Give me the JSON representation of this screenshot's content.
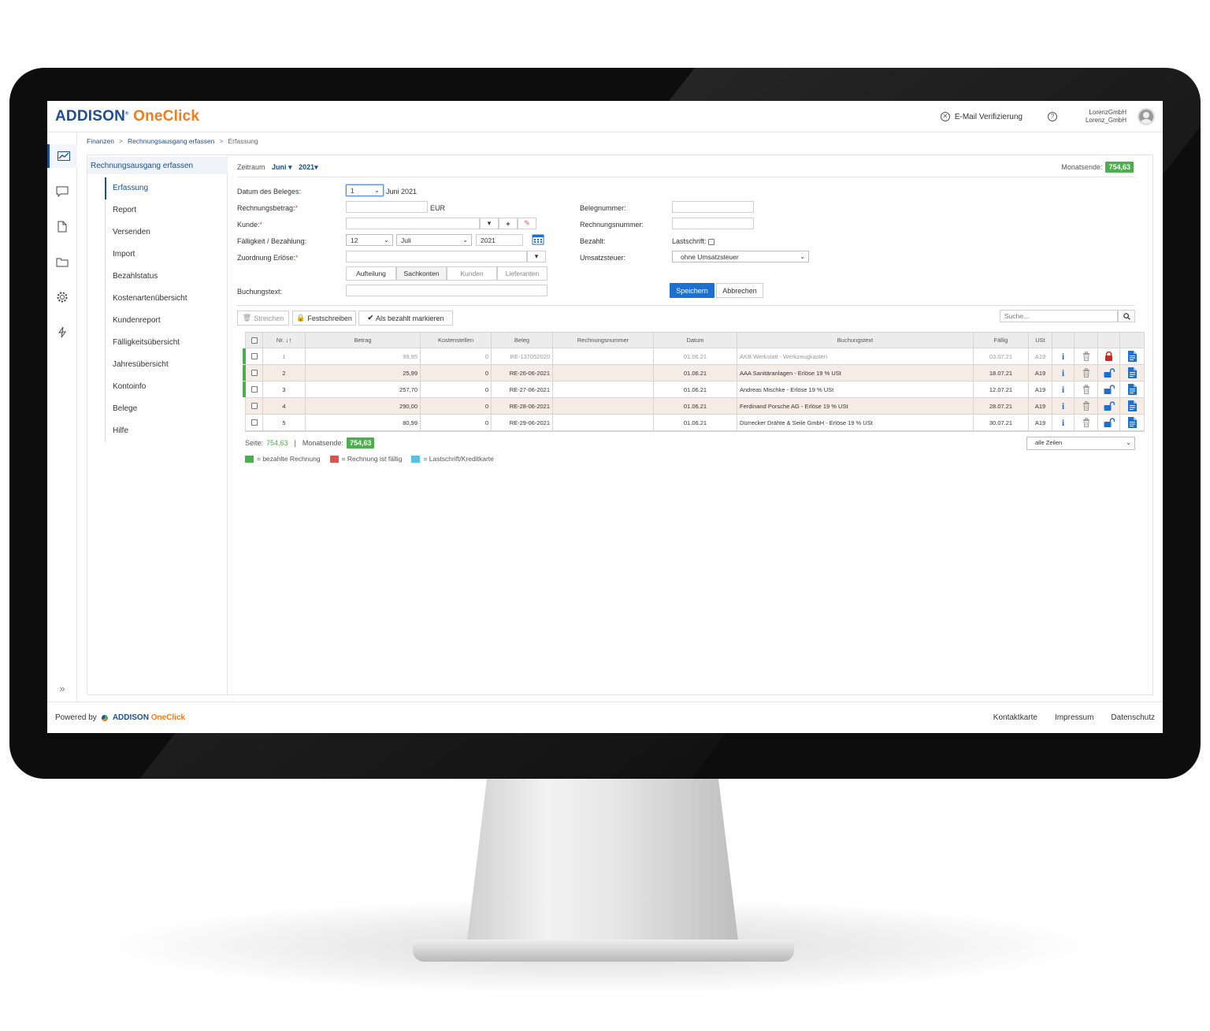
{
  "app": {
    "logo_part1": "ADDISON",
    "logo_part2": "OneClick"
  },
  "header": {
    "email_verify": "E-Mail Verifizierung",
    "help_icon": "?",
    "user_line1": "LorenzGmbH",
    "user_line2": "Lorenz_GmbH"
  },
  "breadcrumb": [
    "Finanzen",
    "Rechnungsausgang erfassen",
    "Erfassung"
  ],
  "iconbar": [
    "chart-icon",
    "chat-icon",
    "document-icon",
    "folder-icon",
    "gear-icon",
    "lightning-icon"
  ],
  "expand_icon": "»",
  "subnav": {
    "title": "Rechnungsausgang erfassen",
    "items": [
      "Erfassung",
      "Report",
      "Versenden",
      "Import",
      "Bezahlstatus",
      "Kostenartenübersicht",
      "Kundenreport",
      "Fälligkeitsübersicht",
      "Jahresübersicht",
      "Kontoinfo",
      "Belege",
      "Hilfe"
    ]
  },
  "zeitraum": {
    "label": "Zeitraum",
    "month": "Juni",
    "year": "2021"
  },
  "monatsende": {
    "label": "Monatsende:",
    "value": "754,63"
  },
  "form": {
    "datum_label": "Datum des Beleges:",
    "datum_day": "1",
    "datum_suffix": "Juni 2021",
    "betrag_label": "Rechnungsbetrag:",
    "betrag_unit": "EUR",
    "kunde_label": "Kunde:",
    "faellig_label": "Fälligkeit / Bezahlung:",
    "faellig_day": "12",
    "faellig_month": "Juli",
    "faellig_year": "2021",
    "zuordnung_label": "Zuordnung Erlöse:",
    "seg": [
      "Aufteilung",
      "Sachkonten",
      "Kunden",
      "Lieferanten"
    ],
    "buchungstext_label": "Buchungstext:",
    "belegnummer_label": "Belegnummer:",
    "rechnungsnummer_label": "Rechnungsnummer:",
    "bezahlt_label": "Bezahlt:",
    "lastschrift_label": "Lastschrift:",
    "ust_label": "Umsatzsteuer:",
    "ust_value": "ohne Umsatzsteuer",
    "save": "Speichern",
    "cancel": "Abbrechen",
    "required_mark": "*"
  },
  "toolbar": {
    "streichen": "Streichen",
    "festschreiben": "Festschreiben",
    "bezahlt": "Als bezahlt markieren",
    "search_placeholder": "Suche..."
  },
  "table": {
    "headers": [
      "Nr.",
      "Betrag",
      "Kostenstellen",
      "Beleg",
      "Rechnungsnummer",
      "Datum",
      "Buchungstext",
      "Fällig",
      "USt"
    ],
    "rows": [
      {
        "nr": "1",
        "betrag": "99,95",
        "kst": "0",
        "beleg": "RE-137052020",
        "rnr": "",
        "datum": "01.06.21",
        "text": "AKB Werkstatt - Werkzeugkasten",
        "faellig": "03.07.21",
        "ust": "A19",
        "paid": true,
        "locked": true,
        "muted": true
      },
      {
        "nr": "2",
        "betrag": "25,99",
        "kst": "0",
        "beleg": "RE-26-06-2021",
        "rnr": "",
        "datum": "01.06.21",
        "text": "AAA Sanitäranlagen - Erlöse 19 % USt",
        "faellig": "18.07.21",
        "ust": "A19",
        "paid": true,
        "locked": false,
        "muted": false
      },
      {
        "nr": "3",
        "betrag": "257,70",
        "kst": "0",
        "beleg": "RE-27-06-2021",
        "rnr": "",
        "datum": "01.06.21",
        "text": "Andreas Mischke - Erlöse 19 % USt",
        "faellig": "12.07.21",
        "ust": "A19",
        "paid": true,
        "locked": false,
        "muted": false
      },
      {
        "nr": "4",
        "betrag": "290,00",
        "kst": "0",
        "beleg": "RE-28-06-2021",
        "rnr": "",
        "datum": "01.06.21",
        "text": "Ferdinand Porsche AG - Erlöse 19 % USt",
        "faellig": "28.07.21",
        "ust": "A19",
        "paid": false,
        "locked": false,
        "muted": false
      },
      {
        "nr": "5",
        "betrag": "80,99",
        "kst": "0",
        "beleg": "RE-29-06-2021",
        "rnr": "",
        "datum": "01.06.21",
        "text": "Dürrecker Drähte & Seile GmbH - Erlöse 19 % USt",
        "faellig": "30.07.21",
        "ust": "A19",
        "paid": false,
        "locked": false,
        "muted": false
      }
    ]
  },
  "summary": {
    "seite_label": "Seite:",
    "seite_value": "754,63",
    "sep": "|",
    "monatsende_label": "Monatsende:",
    "monatsende_value": "754,63",
    "rows_select": "alle Zeilen"
  },
  "legend": [
    {
      "color": "#4cae4c",
      "text": "= bezahlte Rechnung"
    },
    {
      "color": "#d9534f",
      "text": "= Rechnung ist fällig"
    },
    {
      "color": "#5bc0de",
      "text": "= Lastschrift/Kreditkarte"
    }
  ],
  "footer": {
    "powered": "Powered by",
    "links": [
      "Kontaktkarte",
      "Impressum",
      "Datenschutz"
    ]
  }
}
